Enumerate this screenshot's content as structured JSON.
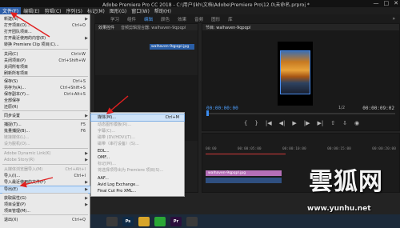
{
  "window": {
    "title": "Adobe Premiere Pro CC 2018 - C:\\用户\\lkh\\文档\\Adobe\\Premiere Pro\\12.0\\未命名.prproj *",
    "buttons": {
      "minimize": "—",
      "maximize": "□",
      "close": "✕"
    }
  },
  "menubar": [
    "文件(F)",
    "编辑(E)",
    "剪辑(C)",
    "序列(S)",
    "标记(M)",
    "图形(G)",
    "窗口(W)",
    "帮助(H)"
  ],
  "workspace_tabs": [
    "学习",
    "组件",
    "编辑",
    "颜色",
    "效果",
    "音频",
    "图形",
    "库"
  ],
  "workspace_active": 2,
  "workspace_more": "»",
  "source_panel": {
    "tabs": [
      "效果控件",
      "音频剪辑混合器: walhaven-9qpqpl"
    ],
    "clip_label": "walhaven-9qpqpl.jpg"
  },
  "program_panel": {
    "tab": "节目: walhaven-9qpqpl",
    "timecode_current": "00:00:00:00",
    "timecode_duration": "00:00:09:02",
    "fit": "1/2"
  },
  "transport_icons": [
    "mark-in-icon",
    "mark-out-icon",
    "go-to-in-icon",
    "step-back-icon",
    "play-icon",
    "step-forward-icon",
    "go-to-out-icon",
    "lift-icon",
    "extract-icon",
    "export-frame-icon"
  ],
  "transport_glyphs": [
    "{",
    "}",
    "|◀",
    "◀|",
    "▶",
    "|▶",
    "▶|",
    "⇧",
    "⇩",
    "◉"
  ],
  "timeline": {
    "ruler": [
      "00:00",
      "00:00:05:00",
      "00:00:10:00",
      "00:00:15:00",
      "00:00:20:00"
    ],
    "clip_label": "walhaven-9qpqpl.jpg"
  },
  "file_menu": {
    "items": [
      {
        "label": "新建(N)",
        "shortcut": "",
        "arrow": true,
        "disabled": false
      },
      {
        "label": "打开项目(O)...",
        "shortcut": "Ctrl+O",
        "arrow": false,
        "disabled": false
      },
      {
        "label": "打开团队项目...",
        "shortcut": "",
        "arrow": false,
        "disabled": false
      },
      {
        "label": "打开最近使用的内容(E)",
        "shortcut": "",
        "arrow": true,
        "disabled": false
      },
      {
        "label": "转换 Premiere Clip 项目(C)...",
        "shortcut": "",
        "arrow": false,
        "disabled": false
      },
      {
        "label": "关闭(C)",
        "shortcut": "Ctrl+W",
        "arrow": false,
        "disabled": false
      },
      {
        "label": "关闭项目(P)",
        "shortcut": "Ctrl+Shift+W",
        "arrow": false,
        "disabled": false
      },
      {
        "label": "关闭所有项目",
        "shortcut": "",
        "arrow": false,
        "disabled": false
      },
      {
        "label": "刷新所有项目",
        "shortcut": "",
        "arrow": false,
        "disabled": false
      },
      {
        "label": "保存(S)",
        "shortcut": "Ctrl+S",
        "arrow": false,
        "disabled": false
      },
      {
        "label": "另存为(A)...",
        "shortcut": "Ctrl+Shift+S",
        "arrow": false,
        "disabled": false
      },
      {
        "label": "保存副本(Y)...",
        "shortcut": "Ctrl+Alt+S",
        "arrow": false,
        "disabled": false
      },
      {
        "label": "全部保存",
        "shortcut": "",
        "arrow": false,
        "disabled": false
      },
      {
        "label": "还原(R)",
        "shortcut": "",
        "arrow": false,
        "disabled": false
      },
      {
        "label": "同步设置",
        "shortcut": "",
        "arrow": true,
        "disabled": false
      },
      {
        "label": "捕捉(T)...",
        "shortcut": "F5",
        "arrow": false,
        "disabled": false
      },
      {
        "label": "批量捕捉(B)...",
        "shortcut": "F6",
        "arrow": false,
        "disabled": false
      },
      {
        "label": "链接媒体(L)...",
        "shortcut": "",
        "arrow": false,
        "disabled": true
      },
      {
        "label": "设为脱机(O)...",
        "shortcut": "",
        "arrow": false,
        "disabled": true
      },
      {
        "label": "Adobe Dynamic Link(K)",
        "shortcut": "",
        "arrow": true,
        "disabled": true
      },
      {
        "label": "Adobe Story(R)",
        "shortcut": "",
        "arrow": true,
        "disabled": true
      },
      {
        "label": "从媒体浏览器导入(M)",
        "shortcut": "Ctrl+Alt+I",
        "arrow": false,
        "disabled": true
      },
      {
        "label": "导入(I)...",
        "shortcut": "Ctrl+I",
        "arrow": false,
        "disabled": false
      },
      {
        "label": "导入最近使用的文件(F)",
        "shortcut": "",
        "arrow": true,
        "disabled": false
      },
      {
        "label": "导出(E)",
        "shortcut": "",
        "arrow": true,
        "disabled": false,
        "highlighted": true
      },
      {
        "label": "获取属性(G)",
        "shortcut": "",
        "arrow": true,
        "disabled": false
      },
      {
        "label": "项目设置(P)",
        "shortcut": "",
        "arrow": true,
        "disabled": false
      },
      {
        "label": "项目管理(M)...",
        "shortcut": "",
        "arrow": false,
        "disabled": false
      },
      {
        "label": "退出(X)",
        "shortcut": "Ctrl+Q",
        "arrow": false,
        "disabled": false
      }
    ]
  },
  "export_submenu": {
    "items": [
      {
        "label": "媒体(M)...",
        "shortcut": "Ctrl+M",
        "disabled": false,
        "highlighted": true
      },
      {
        "label": "动态图形模板(R)...",
        "shortcut": "",
        "disabled": true
      },
      {
        "label": "字幕(C)...",
        "shortcut": "",
        "disabled": true
      },
      {
        "label": "磁带 (DV/HDV)(T)...",
        "shortcut": "",
        "disabled": true
      },
      {
        "label": "磁带（串行设备）(S)...",
        "shortcut": "",
        "disabled": true
      },
      {
        "label": "EDL...",
        "shortcut": "",
        "disabled": false
      },
      {
        "label": "OMF...",
        "shortcut": "",
        "disabled": false
      },
      {
        "label": "标记(M)...",
        "shortcut": "",
        "disabled": true
      },
      {
        "label": "将选择项导出为 Premiere 项目(S)...",
        "shortcut": "",
        "disabled": true
      },
      {
        "label": "AAF...",
        "shortcut": "",
        "disabled": false
      },
      {
        "label": "Avid Log Exchange...",
        "shortcut": "",
        "disabled": false
      },
      {
        "label": "Final Cut Pro XML...",
        "shortcut": "",
        "disabled": false
      }
    ]
  },
  "taskbar": [
    {
      "name": "chrome-taskbar-icon",
      "label": "",
      "color": "#3a3a3a"
    },
    {
      "name": "photoshop-taskbar-icon",
      "label": "Ps",
      "color": "#0f2b47"
    },
    {
      "name": "explorer-taskbar-icon",
      "label": "",
      "color": "#d8a52a"
    },
    {
      "name": "wechat-taskbar-icon",
      "label": "",
      "color": "#2aa836"
    },
    {
      "name": "premiere-taskbar-icon",
      "label": "Pr",
      "color": "#2c0f3d"
    },
    {
      "name": "app-taskbar-icon",
      "label": "",
      "color": "#3a3a3a"
    }
  ],
  "watermark": {
    "text": "雲狐网",
    "url": "www.yunhu.net"
  }
}
